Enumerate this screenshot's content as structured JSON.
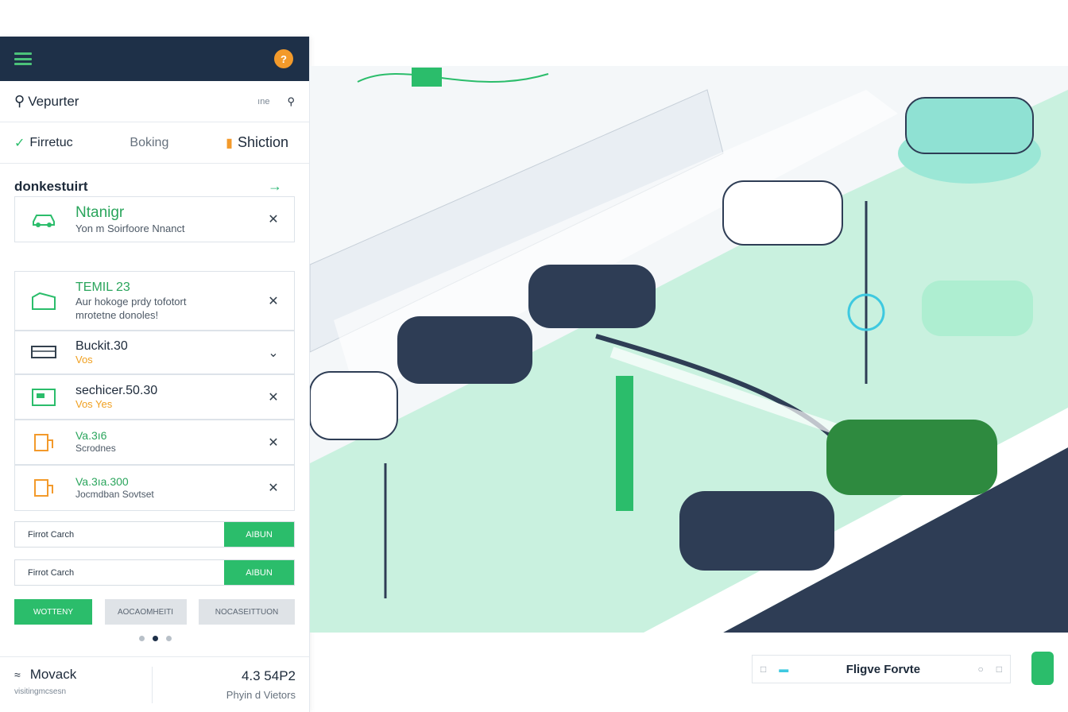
{
  "app": {
    "user_initial": "?"
  },
  "search": {
    "title": "Vepurter",
    "hint": "ıne"
  },
  "tabs": [
    {
      "label": "Firretuc"
    },
    {
      "label": "Boking"
    },
    {
      "label": "Shiction"
    }
  ],
  "section": {
    "title": "donkestuirt"
  },
  "cards": [
    {
      "title": "Ntanigr",
      "sub1": "Yon m Soirfoore Nnanct"
    },
    {
      "title": "TEMIL 23",
      "sub1": "Aur hokoge prdy tofotort",
      "sub2": "mrotetne donoles!"
    },
    {
      "title": "Buckit.30",
      "sub1": "Vos"
    },
    {
      "title": "sechicer.50.30",
      "sub1": "Vos Yes"
    },
    {
      "title": "Va.3ı6",
      "sub1": "Scrodnes"
    },
    {
      "title": "Va.3ıa.300",
      "sub1": "Jocmdban Sovtset"
    }
  ],
  "inputs": [
    {
      "text": "Firrot Carch",
      "button": "AIBUN"
    },
    {
      "text": "Firrot Carch",
      "button": "AIBUN"
    }
  ],
  "buttons": [
    "WOTTENY",
    "AOCAOMHEITI",
    "NOCASEITTUON"
  ],
  "footer": {
    "name": "Movack",
    "caption": "visitingmcsesn",
    "number": "4.3 54P2",
    "number_caption": "Phyin d Vietors"
  },
  "bottom_bar": {
    "label": "Fligve Forvte"
  },
  "colors": {
    "navy": "#1e3048",
    "green": "#2bbd6b",
    "mint": "#bfeed7",
    "orange": "#f39a2b"
  }
}
